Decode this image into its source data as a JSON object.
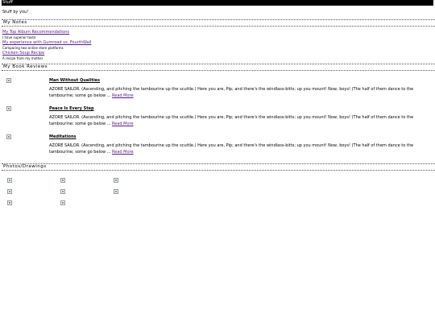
{
  "header": {
    "title": "Stuff"
  },
  "tagline": "Stuff by you!",
  "sections": {
    "notes": "My Notes",
    "reviews": "My Book Reviews",
    "photos": "Photos/Drawings"
  },
  "notes": [
    {
      "link": "My Top Album Recommendations",
      "desc": "I have superior taste"
    },
    {
      "link": "My experience with Gumroad vs. FourthWall",
      "desc": "Comparing two online store platforms"
    },
    {
      "link": "Chicken Soup Recipe",
      "desc": "A recipe from my mother"
    }
  ],
  "reviews": [
    {
      "title": "Man Without Qualities",
      "text": "AZORE SAILOR. (Ascending, and pitching the tambourine up the scuttle.) Here you are, Pip; and there's the windlass-bitts; up you mount! Now, boys! (The half of them dance to the tambourine; some go below ...",
      "more": "Read More"
    },
    {
      "title": "Peace Is Every Step",
      "text": "AZORE SAILOR. (Ascending, and pitching the tambourine up the scuttle.) Here you are, Pip; and there's the windlass-bitts; up you mount! Now, boys! (The half of them dance to the tambourine; some go below ...",
      "more": "Read More"
    },
    {
      "title": "Meditations",
      "text": "AZORE SAILOR. (Ascending, and pitching the tambourine up the scuttle.) Here you are, Pip; and there's the windlass-bitts; up you mount! Now, boys! (The half of them dance to the tambourine; some go below ...",
      "more": "Read More"
    }
  ],
  "icons": {
    "broken_image": "broken-image-icon"
  }
}
